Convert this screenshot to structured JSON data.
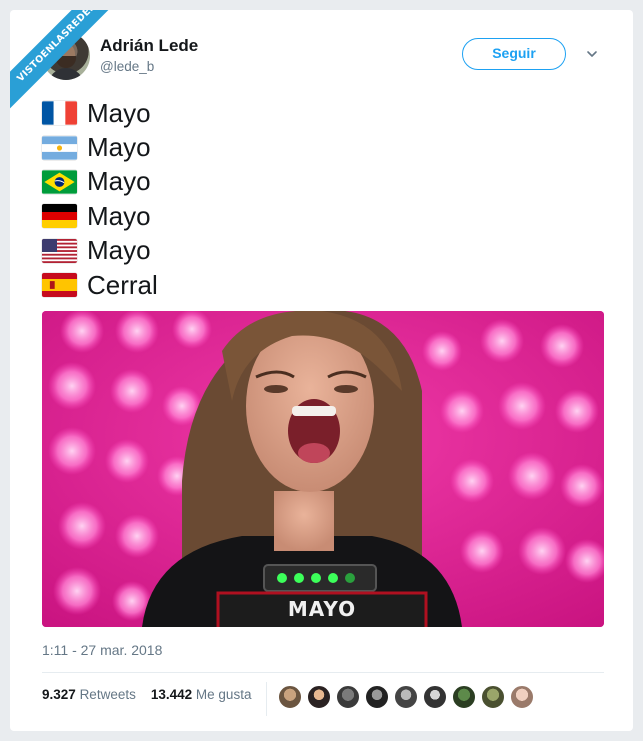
{
  "watermark": "VISTOENLASREDES",
  "author": {
    "name": "Adrián Lede",
    "handle": "@lede_b"
  },
  "follow_label": "Seguir",
  "lines": [
    {
      "flag": "france",
      "text": "Mayo"
    },
    {
      "flag": "argentina",
      "text": "Mayo"
    },
    {
      "flag": "brazil",
      "text": "Mayo"
    },
    {
      "flag": "germany",
      "text": "Mayo"
    },
    {
      "flag": "usa",
      "text": "Mayo"
    },
    {
      "flag": "spain",
      "text": "Cerral"
    }
  ],
  "media": {
    "caption": "MAYO"
  },
  "timestamp": "1:11 - 27 mar. 2018",
  "stats": {
    "retweets_count": "9.327",
    "retweets_label": "Retweets",
    "likes_count": "13.442",
    "likes_label": "Me gusta"
  },
  "icons": {
    "caret": "chevron-down-icon"
  },
  "colors": {
    "accent": "#1da1f2",
    "ribbon": "#2a9fd6",
    "media_bg": "#e11d9a"
  }
}
